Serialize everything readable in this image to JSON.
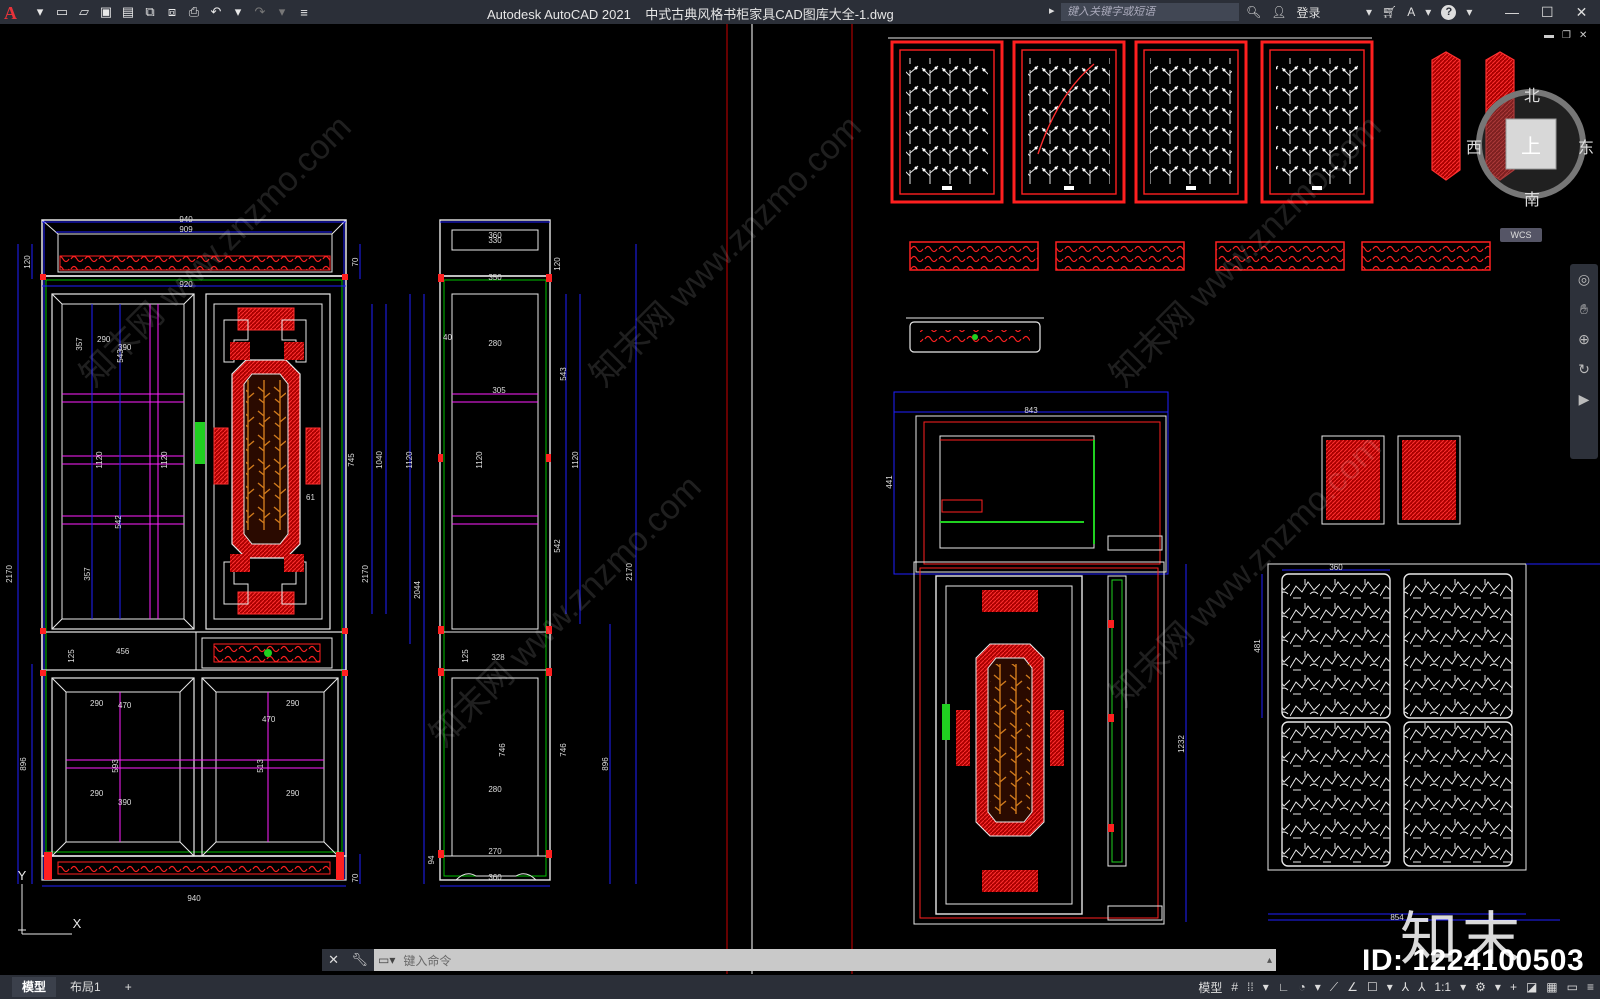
{
  "titlebar": {
    "app_title": "Autodesk AutoCAD 2021",
    "file_name": "中式古典风格书柜家具CAD图库大全-1.dwg",
    "search_placeholder": "键入关键字或短语",
    "login_label": "登录",
    "help_label": "?"
  },
  "viewcube": {
    "north": "北",
    "south": "南",
    "east": "东",
    "west": "西",
    "top": "上",
    "wcs": "WCS"
  },
  "command": {
    "placeholder": "键入命令"
  },
  "tabs": [
    {
      "label": "模型"
    },
    {
      "label": "布局1"
    },
    {
      "label": "+"
    }
  ],
  "status": {
    "model_label": "模型",
    "scale_label": "1:1"
  },
  "watermark": {
    "id_text": "ID: 1224100503",
    "logo_text": "知末",
    "site": "知末网 www.znzmo.com"
  },
  "ucs": {
    "x": "X",
    "y": "Y"
  },
  "dims": {
    "d940_top": "940",
    "d909": "909",
    "d920": "920",
    "d120a": "120",
    "d70a": "70",
    "d290a": "290",
    "d390a": "390",
    "d357a": "357",
    "d543": "543",
    "d1120a": "1120",
    "d1120b": "1120",
    "d542": "542",
    "d357b": "357",
    "d745": "745",
    "d1040": "1040",
    "d61": "61",
    "d2170a": "2170",
    "d2170b": "2170",
    "d125a": "125",
    "d456": "456",
    "d290b": "290",
    "d470a": "470",
    "d290c": "290",
    "d470b": "470",
    "d593": "593",
    "d513": "513",
    "d290d": "290",
    "d390b": "390",
    "d290e": "290",
    "d896a": "896",
    "d70b": "70",
    "d940_bot": "940",
    "s360a": "360",
    "s330": "330",
    "s350": "350",
    "s120": "120",
    "s40": "40",
    "s280a": "280",
    "s305": "305",
    "s543": "543",
    "s1120a": "1120",
    "s1120b": "1120",
    "s1120c": "1120",
    "s542": "542",
    "s2044": "2044",
    "s2170": "2170",
    "s125": "125",
    "s328": "328",
    "s746a": "746",
    "s746b": "746",
    "s896": "896",
    "s280b": "280",
    "s94": "94",
    "s270": "270",
    "s360b": "360",
    "p843": "843",
    "p441": "441",
    "p1232": "1232",
    "p360": "360",
    "p481": "481",
    "p854": "854"
  }
}
